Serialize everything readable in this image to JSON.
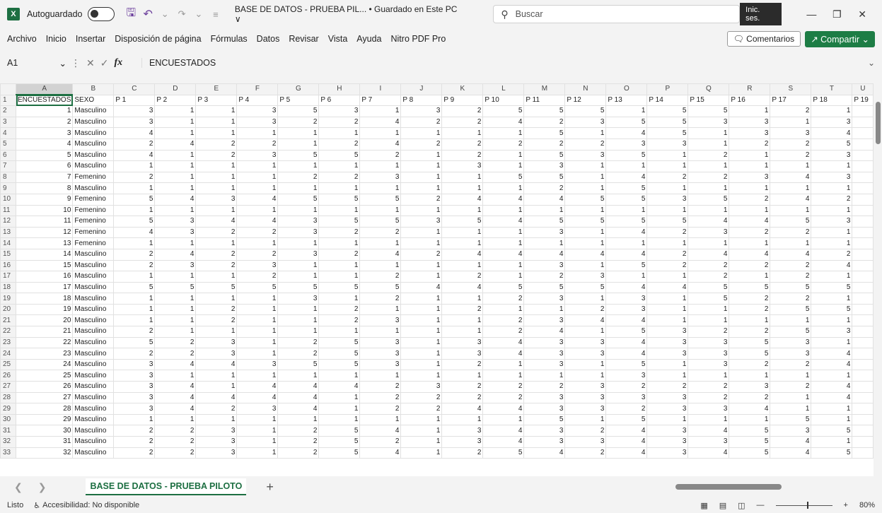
{
  "titlebar": {
    "logo": "X",
    "autosave_label": "Autoguardado",
    "doc_title": "BASE DE DATOS - PRUEBA PIL... • Guardado en Este PC ∨",
    "search_placeholder": "Buscar",
    "signin": "Inic. ses."
  },
  "menu": {
    "items": [
      "Archivo",
      "Inicio",
      "Insertar",
      "Disposición de página",
      "Fórmulas",
      "Datos",
      "Revisar",
      "Vista",
      "Ayuda",
      "Nitro PDF Pro"
    ],
    "comentarios": "Comentarios",
    "compartir": "Compartir"
  },
  "formula": {
    "cell_ref": "A1",
    "content": "ENCUESTADOS"
  },
  "columns": [
    "A",
    "B",
    "C",
    "D",
    "E",
    "F",
    "G",
    "H",
    "I",
    "J",
    "K",
    "L",
    "M",
    "N",
    "O",
    "P",
    "Q",
    "R",
    "S",
    "T",
    "U"
  ],
  "header_row": [
    "ENCUESTADOS",
    "SEXO",
    "P 1",
    "P 2",
    "P 3",
    "P 4",
    "P 5",
    "P 6",
    "P 7",
    "P 8",
    "P 9",
    "P 10",
    "P 11",
    "P 12",
    "P 13",
    "P 14",
    "P 15",
    "P 16",
    "P 17",
    "P 18",
    "P 19"
  ],
  "rows": [
    [
      "1",
      "Masculino",
      "3",
      "1",
      "1",
      "3",
      "5",
      "3",
      "1",
      "3",
      "2",
      "5",
      "5",
      "5",
      "1",
      "5",
      "5",
      "1",
      "2",
      "1"
    ],
    [
      "2",
      "Masculino",
      "3",
      "1",
      "1",
      "3",
      "2",
      "2",
      "4",
      "2",
      "2",
      "4",
      "2",
      "3",
      "5",
      "5",
      "3",
      "3",
      "1",
      "3"
    ],
    [
      "3",
      "Masculino",
      "4",
      "1",
      "1",
      "1",
      "1",
      "1",
      "1",
      "1",
      "1",
      "1",
      "5",
      "1",
      "4",
      "5",
      "1",
      "3",
      "3",
      "4"
    ],
    [
      "4",
      "Masculino",
      "2",
      "4",
      "2",
      "2",
      "1",
      "2",
      "4",
      "2",
      "2",
      "2",
      "2",
      "2",
      "3",
      "3",
      "1",
      "2",
      "2",
      "5"
    ],
    [
      "5",
      "Masculino",
      "4",
      "1",
      "2",
      "3",
      "5",
      "5",
      "2",
      "1",
      "2",
      "1",
      "5",
      "3",
      "5",
      "1",
      "2",
      "1",
      "2",
      "3"
    ],
    [
      "6",
      "Masculino",
      "1",
      "1",
      "1",
      "1",
      "1",
      "1",
      "1",
      "1",
      "3",
      "1",
      "3",
      "1",
      "1",
      "1",
      "1",
      "1",
      "1",
      "1"
    ],
    [
      "7",
      "Femenino",
      "2",
      "1",
      "1",
      "1",
      "2",
      "2",
      "3",
      "1",
      "1",
      "5",
      "5",
      "1",
      "4",
      "2",
      "2",
      "3",
      "4",
      "3"
    ],
    [
      "8",
      "Masculino",
      "1",
      "1",
      "1",
      "1",
      "1",
      "1",
      "1",
      "1",
      "1",
      "1",
      "2",
      "1",
      "5",
      "1",
      "1",
      "1",
      "1",
      "1"
    ],
    [
      "9",
      "Femenino",
      "5",
      "4",
      "3",
      "4",
      "5",
      "5",
      "5",
      "2",
      "4",
      "4",
      "4",
      "5",
      "5",
      "3",
      "5",
      "2",
      "4",
      "2"
    ],
    [
      "10",
      "Femenino",
      "1",
      "1",
      "1",
      "1",
      "1",
      "1",
      "1",
      "1",
      "1",
      "1",
      "1",
      "1",
      "1",
      "1",
      "1",
      "1",
      "1",
      "1"
    ],
    [
      "11",
      "Femenino",
      "5",
      "3",
      "4",
      "4",
      "3",
      "5",
      "5",
      "3",
      "5",
      "4",
      "5",
      "5",
      "5",
      "5",
      "4",
      "4",
      "5",
      "3"
    ],
    [
      "12",
      "Femenino",
      "4",
      "3",
      "2",
      "2",
      "3",
      "2",
      "2",
      "1",
      "1",
      "1",
      "3",
      "1",
      "4",
      "2",
      "3",
      "2",
      "2",
      "1"
    ],
    [
      "13",
      "Femenino",
      "1",
      "1",
      "1",
      "1",
      "1",
      "1",
      "1",
      "1",
      "1",
      "1",
      "1",
      "1",
      "1",
      "1",
      "1",
      "1",
      "1",
      "1"
    ],
    [
      "14",
      "Masculino",
      "2",
      "4",
      "2",
      "2",
      "3",
      "2",
      "4",
      "2",
      "4",
      "4",
      "4",
      "4",
      "4",
      "2",
      "4",
      "4",
      "4",
      "2"
    ],
    [
      "15",
      "Masculino",
      "2",
      "3",
      "2",
      "3",
      "1",
      "1",
      "1",
      "1",
      "1",
      "1",
      "3",
      "1",
      "5",
      "2",
      "2",
      "2",
      "2",
      "4"
    ],
    [
      "16",
      "Masculino",
      "1",
      "1",
      "1",
      "2",
      "1",
      "1",
      "2",
      "1",
      "2",
      "1",
      "2",
      "3",
      "1",
      "1",
      "2",
      "1",
      "2",
      "1"
    ],
    [
      "17",
      "Masculino",
      "5",
      "5",
      "5",
      "5",
      "5",
      "5",
      "5",
      "4",
      "4",
      "5",
      "5",
      "5",
      "4",
      "4",
      "5",
      "5",
      "5",
      "5"
    ],
    [
      "18",
      "Masculino",
      "1",
      "1",
      "1",
      "1",
      "3",
      "1",
      "2",
      "1",
      "1",
      "2",
      "3",
      "1",
      "3",
      "1",
      "5",
      "2",
      "2",
      "1"
    ],
    [
      "19",
      "Masculino",
      "1",
      "1",
      "2",
      "1",
      "1",
      "2",
      "1",
      "1",
      "2",
      "1",
      "1",
      "2",
      "3",
      "1",
      "1",
      "2",
      "5",
      "5"
    ],
    [
      "20",
      "Masculino",
      "1",
      "1",
      "2",
      "1",
      "1",
      "2",
      "3",
      "1",
      "1",
      "2",
      "3",
      "4",
      "4",
      "1",
      "1",
      "1",
      "1",
      "1"
    ],
    [
      "21",
      "Masculino",
      "2",
      "1",
      "1",
      "1",
      "1",
      "1",
      "1",
      "1",
      "1",
      "2",
      "4",
      "1",
      "5",
      "3",
      "2",
      "2",
      "5",
      "3"
    ],
    [
      "22",
      "Masculino",
      "5",
      "2",
      "3",
      "1",
      "2",
      "5",
      "3",
      "1",
      "3",
      "4",
      "3",
      "3",
      "4",
      "3",
      "3",
      "5",
      "3",
      "1"
    ],
    [
      "23",
      "Masculino",
      "2",
      "2",
      "3",
      "1",
      "2",
      "5",
      "3",
      "1",
      "3",
      "4",
      "3",
      "3",
      "4",
      "3",
      "3",
      "5",
      "3",
      "4"
    ],
    [
      "24",
      "Masculino",
      "3",
      "4",
      "4",
      "3",
      "5",
      "5",
      "3",
      "1",
      "2",
      "1",
      "3",
      "1",
      "5",
      "1",
      "3",
      "2",
      "2",
      "4"
    ],
    [
      "25",
      "Masculino",
      "3",
      "1",
      "1",
      "1",
      "1",
      "1",
      "1",
      "1",
      "1",
      "1",
      "1",
      "1",
      "3",
      "1",
      "1",
      "1",
      "1",
      "1"
    ],
    [
      "26",
      "Masculino",
      "3",
      "4",
      "1",
      "4",
      "4",
      "4",
      "2",
      "3",
      "2",
      "2",
      "2",
      "3",
      "2",
      "2",
      "2",
      "3",
      "2",
      "4"
    ],
    [
      "27",
      "Masculino",
      "3",
      "4",
      "4",
      "4",
      "4",
      "1",
      "2",
      "2",
      "2",
      "2",
      "3",
      "3",
      "3",
      "3",
      "2",
      "2",
      "1",
      "4"
    ],
    [
      "28",
      "Masculino",
      "3",
      "4",
      "2",
      "3",
      "4",
      "1",
      "2",
      "2",
      "4",
      "4",
      "3",
      "3",
      "2",
      "3",
      "3",
      "4",
      "1",
      "1"
    ],
    [
      "29",
      "Masculino",
      "1",
      "1",
      "1",
      "1",
      "1",
      "1",
      "1",
      "1",
      "1",
      "1",
      "5",
      "1",
      "5",
      "1",
      "1",
      "1",
      "5",
      "1"
    ],
    [
      "30",
      "Masculino",
      "2",
      "2",
      "3",
      "1",
      "2",
      "5",
      "4",
      "1",
      "3",
      "4",
      "3",
      "2",
      "4",
      "3",
      "4",
      "5",
      "3",
      "5"
    ],
    [
      "31",
      "Masculino",
      "2",
      "2",
      "3",
      "1",
      "2",
      "5",
      "2",
      "1",
      "3",
      "4",
      "3",
      "3",
      "4",
      "3",
      "3",
      "5",
      "4",
      "1"
    ],
    [
      "32",
      "Masculino",
      "2",
      "2",
      "3",
      "1",
      "2",
      "5",
      "4",
      "1",
      "2",
      "5",
      "4",
      "2",
      "4",
      "3",
      "4",
      "5",
      "4",
      "5"
    ]
  ],
  "sheet": {
    "tab": "BASE DE DATOS - PRUEBA PILOTO"
  },
  "status": {
    "ready": "Listo",
    "accessibility": "Accesibilidad: No disponible",
    "zoom": "80%"
  }
}
